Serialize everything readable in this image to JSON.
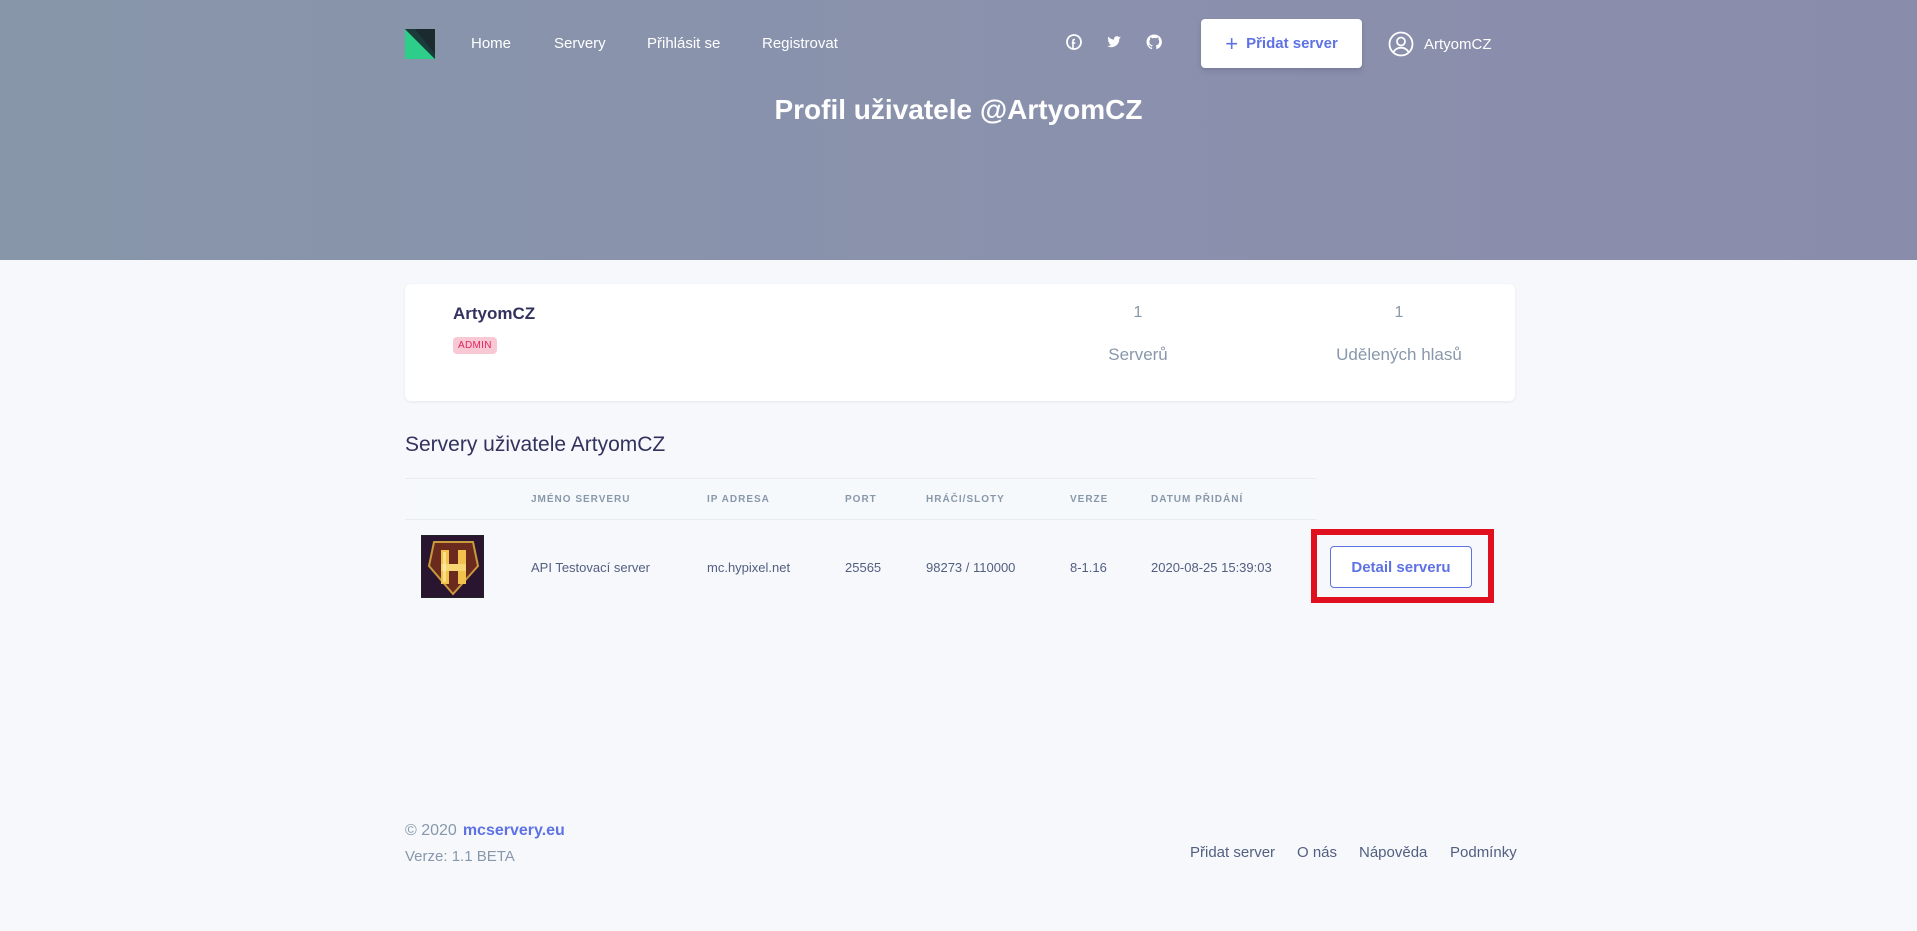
{
  "nav": {
    "links": [
      "Home",
      "Servery",
      "Přihlásit se",
      "Registrovat"
    ],
    "social_icons": [
      "facebook-icon",
      "twitter-icon",
      "github-icon"
    ],
    "add_server_label": "Přidat server",
    "username": "ArtyomCZ"
  },
  "hero": {
    "title": "Profil uživatele @ArtyomCZ"
  },
  "profile": {
    "name": "ArtyomCZ",
    "badge": "ADMIN",
    "stats": [
      {
        "value": "1",
        "label": "Serverů"
      },
      {
        "value": "1",
        "label": "Udělených hlasů"
      }
    ]
  },
  "servers": {
    "title": "Servery uživatele ArtyomCZ",
    "columns": [
      "JMÉNO SERVERU",
      "IP ADRESA",
      "PORT",
      "HRÁČI/SLOTY",
      "VERZE",
      "DATUM PŘIDÁNÍ"
    ],
    "rows": [
      {
        "name": "API Testovací server",
        "ip": "mc.hypixel.net",
        "port": "25565",
        "players": "98273 / 110000",
        "version": "8-1.16",
        "added": "2020-08-25 15:39:03",
        "button": "Detail serveru"
      }
    ]
  },
  "footer": {
    "copyright": "© 2020",
    "site": "mcservery.eu",
    "version": "Verze: 1.1 BETA",
    "links": [
      "Přidat server",
      "O nás",
      "Nápověda",
      "Podmínky"
    ]
  },
  "colors": {
    "accent": "#5e72e4",
    "highlight": "#e0101f",
    "badge_text": "#e0255b"
  }
}
